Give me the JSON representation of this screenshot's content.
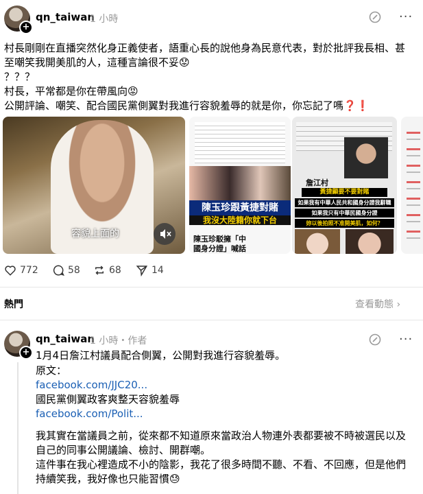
{
  "post": {
    "username": "qn_taiwan",
    "time": "1 小時",
    "lines": [
      "村長剛剛在直播突然化身正義使者，語重心長的說他身為民意代表，對於批評我長相、甚",
      "至嘲笑我開美肌的人，這種言論很不妥😟",
      "？？？",
      "村長，平常都是你在帶風向😡",
      "公開評論、嘲笑、配合國民黨側翼對我進行容貌羞辱的就是你，你忘記了嗎❓❗"
    ],
    "video_caption": "容貌上面的",
    "media2": {
      "headline1": "陳玉珍跟黃捷對賭",
      "headline2": "我沒大陸籍你就下台",
      "sub1": "陳玉珍駁擁「中",
      "sub2": "國身分證」喊話"
    },
    "media3": {
      "top": "詹江村",
      "l1": "黃捷顯要不要對賭",
      "l2": "如果我有中華人民共和國身分證我辭職",
      "l3": "如果我只有中華民國身分證",
      "l4": "妳以後拍照不准開美肌，如何？"
    },
    "stats": {
      "likes": "772",
      "comments": "58",
      "reposts": "68",
      "shares": "14"
    }
  },
  "replies_bar": {
    "label": "熱門",
    "view_activity": "查看動態"
  },
  "reply": {
    "username": "qn_taiwan",
    "time": "1 小時",
    "author_tag": "作者",
    "l1": "1月4日詹江村議員配合側翼，公開對我進行容貌羞辱。",
    "l2": "原文：",
    "link1": "facebook.com/JJC20...",
    "l3": "國民黨側翼政客爽整天容貌羞辱",
    "link2": "facebook.com/Polit...",
    "p1a": "我其實在當議員之前，從來都不知道原來當政治人物連外表都要被不時被選民以及",
    "p1b": "自己的同事公開議論、檢討、開群嘲。",
    "p2a": "這件事在我心裡造成不小的陰影，我花了很多時間不聽、不看、不回應，但是他們",
    "p2b": "持續笑我，我好像也只能習慣😓"
  }
}
